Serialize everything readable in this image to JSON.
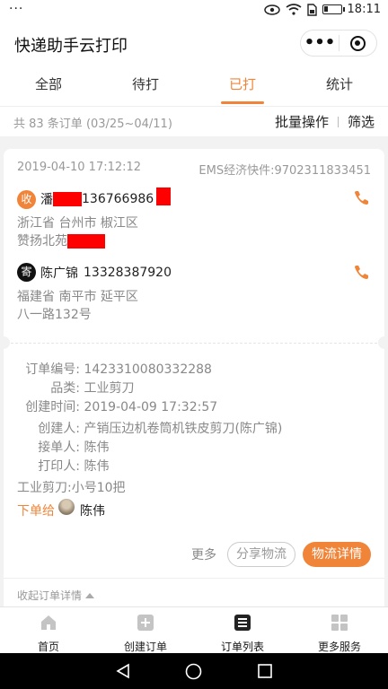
{
  "status_bar": {
    "time": "18:11",
    "menu_dots": "···"
  },
  "app": {
    "title": "快递助手云打印",
    "capsule_more": "•••"
  },
  "tabs": [
    {
      "label": "全部",
      "active": false
    },
    {
      "label": "待打",
      "active": false
    },
    {
      "label": "已打",
      "active": true
    },
    {
      "label": "统计",
      "active": false
    }
  ],
  "subbar": {
    "count": "共 83 条订单 (03/25~04/11)",
    "batch": "批量操作",
    "filter": "筛选"
  },
  "order": {
    "datetime": "2019-04-10 17:12:12",
    "express": "EMS经济快件:9702311833451",
    "receiver": {
      "badge": "收",
      "name": "潘",
      "phone": "136766986",
      "region": "浙江省 台州市 椒江区",
      "street": "赞扬北苑"
    },
    "sender": {
      "badge": "寄",
      "name": "陈广锦",
      "phone": "13328387920",
      "region": "福建省 南平市 延平区",
      "street": "八一路132号"
    },
    "details": {
      "order_no_label": "订单编号:",
      "order_no": "1423310080332288",
      "category_label": "品类:",
      "category": "工业剪刀",
      "created_label": "创建时间:",
      "created": "2019-04-09 17:32:57",
      "creator_label": "创建人:",
      "creator": "产销压边机卷筒机铁皮剪刀(陈广锦)",
      "taker_label": "接单人:",
      "taker": "陈伟",
      "printer_label": "打印人:",
      "printer": "陈伟",
      "goods": "工业剪刀:小号10把",
      "order_to_label": "下单给",
      "order_to": "陈伟"
    },
    "buttons": {
      "more": "更多",
      "share": "分享物流",
      "logistics": "物流详情"
    },
    "collapse": "收起订单详情"
  },
  "bottom_nav": [
    {
      "label": "首页",
      "icon": "home-icon"
    },
    {
      "label": "创建订单",
      "icon": "plus-square-icon"
    },
    {
      "label": "订单列表",
      "icon": "list-icon",
      "active": true
    },
    {
      "label": "更多服务",
      "icon": "grid-icon"
    }
  ],
  "colors": {
    "accent": "#f0853a",
    "redaction": "#ff0000"
  }
}
